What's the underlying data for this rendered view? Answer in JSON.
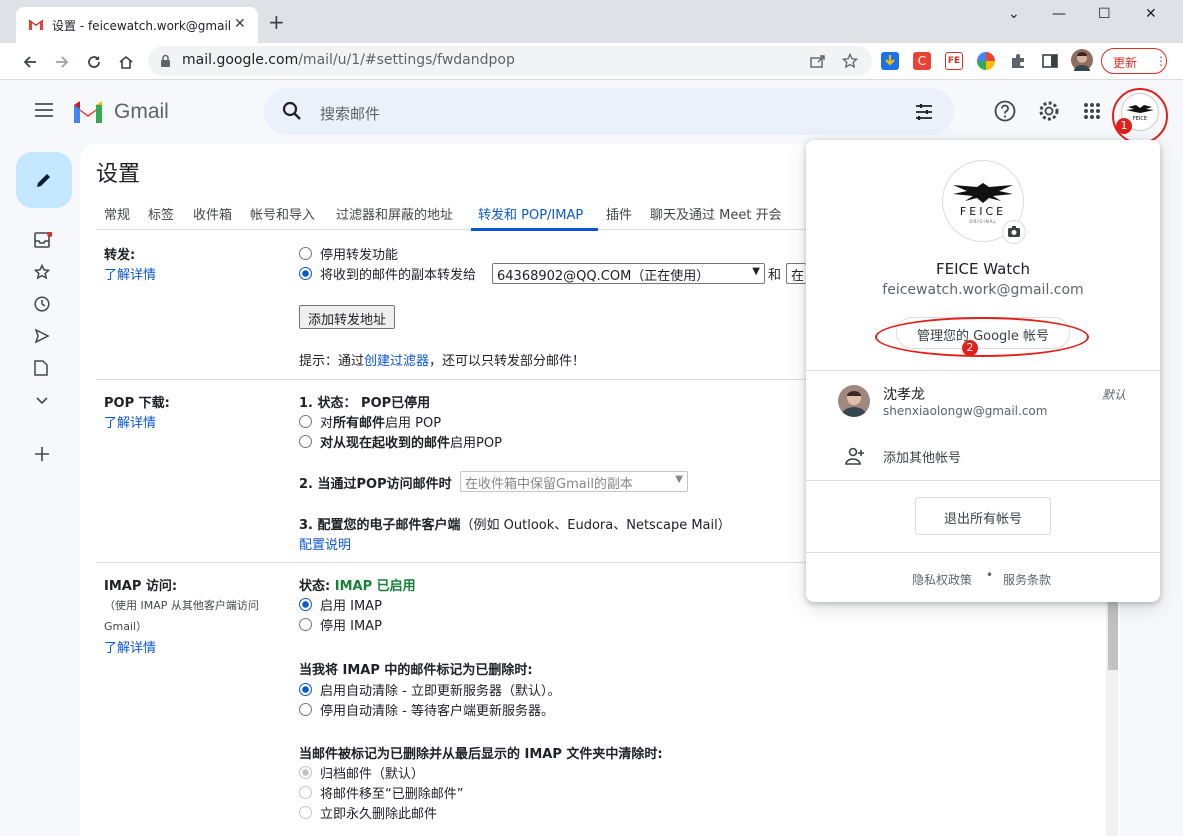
{
  "browser": {
    "tab_title": "设置 - feicewatch.work@gmail.com",
    "tab_close": "✕",
    "new_tab": "+",
    "url_host": "mail.google.com",
    "url_path": "/mail/u/1/#settings/fwdandpop",
    "update_label": "更新",
    "win_minimize": "—",
    "win_maximize": "☐",
    "win_close": "✕",
    "win_chevron": "⌄"
  },
  "gmail": {
    "brand": "Gmail",
    "search_placeholder": "搜索邮件"
  },
  "settings": {
    "title": "设置",
    "tabs": [
      "常规",
      "标签",
      "收件箱",
      "帐号和导入",
      "过滤器和屏蔽的地址",
      "转发和 POP/IMAP",
      "插件",
      "聊天及通过 Meet 开会"
    ],
    "forwarding": {
      "heading": "转发:",
      "learn_more": "了解详情",
      "opt_disable": "停用转发功能",
      "opt_forward": "将收到的邮件的副本转发给",
      "forward_address": "64368902@QQ.COM（正在使用）",
      "and_label": "和",
      "second_select": "在",
      "add_button": "添加转发地址",
      "tip_prefix": "提示：通过",
      "tip_link": "创建过滤器",
      "tip_suffix": "，还可以只转发部分邮件！"
    },
    "pop": {
      "heading": "POP 下载:",
      "learn_more": "了解详情",
      "status_label": "1. 状态：",
      "status_value": "POP已停用",
      "opt_all_prefix": "对",
      "opt_all_bold": "所有邮件",
      "opt_all_suffix": "启用 POP",
      "opt_now_bold": "对从现在起收到的邮件",
      "opt_now_suffix": "启用POP",
      "access_label": "2. 当通过POP访问邮件时",
      "access_select": "在收件箱中保留Gmail的副本",
      "config_label": "3. 配置您的电子邮件客户端",
      "config_example": "（例如 Outlook、Eudora、Netscape Mail）",
      "config_link": "配置说明"
    },
    "imap": {
      "heading": "IMAP 访问:",
      "sub1": "（使用 IMAP 从其他客户端访问",
      "sub2": "Gmail）",
      "learn_more": "了解详情",
      "status_label": "状态:",
      "status_value": "IMAP 已启用",
      "opt_enable": "启用 IMAP",
      "opt_disable": "停用 IMAP",
      "deleted_heading": "当我将 IMAP 中的邮件标记为已删除时:",
      "opt_auto_on": "启用自动清除 - 立即更新服务器（默认）。",
      "opt_auto_off": "停用自动清除 - 等待客户端更新服务器。",
      "expunge_heading": "当邮件被标记为已删除并从最后显示的 IMAP 文件夹中清除时:",
      "opt_archive": "归档邮件（默认）",
      "opt_trash": "将邮件移至“已删除邮件”",
      "opt_delete": "立即永久删除此邮件"
    }
  },
  "account_popup": {
    "name": "FEICE Watch",
    "email": "feicewatch.work@gmail.com",
    "manage_button": "管理您的 Google 帐号",
    "other_account_name": "沈孝龙",
    "other_account_email": "shenxiaolongw@gmail.com",
    "default_label": "默认",
    "add_account": "添加其他帐号",
    "sign_out_all": "退出所有帐号",
    "privacy": "隐私权政策",
    "terms": "服务条款",
    "separator": "•",
    "logo_text": "FEICE",
    "logo_sub": "ORIGINAL"
  },
  "annotations": {
    "marker1": "1",
    "marker2": "2"
  },
  "colors": {
    "accent": "#0b57d0",
    "annotation_red": "#e0211b",
    "imap_enabled_green": "#188038",
    "gmail_red": "#ea4335"
  }
}
